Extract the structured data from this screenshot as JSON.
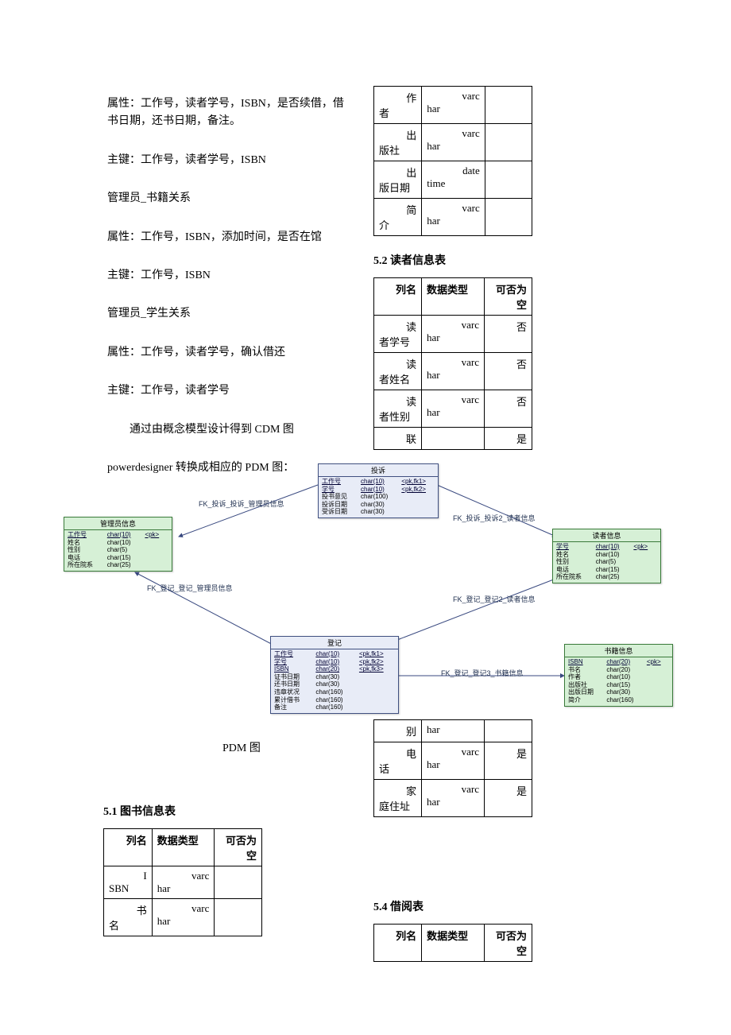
{
  "text": {
    "p1": "属性：工作号，读者学号，ISBN，是否续借，借书日期，还书日期，备注。",
    "p2": "主键：工作号，读者学号，ISBN",
    "p3": "管理员_书籍关系",
    "p4": "属性：工作号，ISBN，添加时间，是否在馆",
    "p5": "主键：工作号，ISBN",
    "p6": "管理员_学生关系",
    "p7": "属性：工作号，读者学号，确认借还",
    "p8": "主键：工作号，读者学号",
    "p9": "通过由概念模型设计得到 CDM 图",
    "p10": "powerdesigner 转换成相应的 PDM 图：",
    "pdm_label": "PDM 图",
    "sec51": "5.1 图书信息表",
    "sec52": "5.2 读者信息表",
    "sec54": "5.4 借阅表",
    "hdr_col": "列名",
    "hdr_type": "数据类型",
    "hdr_type2": "数据类型",
    "hdr_null": "可否为空"
  },
  "table_top": {
    "rows": [
      {
        "c1": "作者",
        "c2a": "varc",
        "c2b": "har",
        "c3": ""
      },
      {
        "c1": "出版社",
        "c2a": "varc",
        "c2b": "har",
        "c3": ""
      },
      {
        "c1": "出版日期",
        "c2a": "date",
        "c2b": "time",
        "c3": ""
      },
      {
        "c1": "简介",
        "c2a": "varc",
        "c2b": "har",
        "c3": ""
      }
    ]
  },
  "table52": {
    "rows": [
      {
        "c1": "读者学号",
        "c2a": "varc",
        "c2b": "har",
        "c3": "否"
      },
      {
        "c1": "读者姓名",
        "c2a": "varc",
        "c2b": "har",
        "c3": "否"
      },
      {
        "c1": "读者性别",
        "c2a": "varc",
        "c2b": "har",
        "c3": "否"
      },
      {
        "c1": "联",
        "c2a": "",
        "c2b": "",
        "c3": "是"
      }
    ]
  },
  "table52b": {
    "rows": [
      {
        "c1": "别",
        "c2a": "",
        "c2b": "har",
        "c3": ""
      },
      {
        "c1": "电话",
        "c2a": "varc",
        "c2b": "har",
        "c3": "是"
      },
      {
        "c1": "家庭住址",
        "c2a": "varc",
        "c2b": "har",
        "c3": "是"
      }
    ]
  },
  "table51": {
    "rows": [
      {
        "c1": "ISBN",
        "c2a": "varc",
        "c2b": "har",
        "c3": ""
      },
      {
        "c1": "书名",
        "c2a": "varc",
        "c2b": "har",
        "c3": ""
      }
    ]
  },
  "table54": {
    "hdr_col_short": "列名",
    "hdr_type_short": "数据类型",
    "hdr_null_short": "可否为空"
  },
  "diagram": {
    "admin": {
      "title": "管理员信息",
      "rows": [
        [
          "工作号",
          "char(10)",
          "<pk>"
        ],
        [
          "姓名",
          "char(10)",
          ""
        ],
        [
          "性别",
          "char(5)",
          ""
        ],
        [
          "电话",
          "char(15)",
          ""
        ],
        [
          "所在院系",
          "char(25)",
          ""
        ]
      ]
    },
    "reader": {
      "title": "读者信息",
      "rows": [
        [
          "学号",
          "char(10)",
          "<pk>"
        ],
        [
          "姓名",
          "char(10)",
          ""
        ],
        [
          "性别",
          "char(5)",
          ""
        ],
        [
          "电话",
          "char(15)",
          ""
        ],
        [
          "所在院系",
          "char(25)",
          ""
        ]
      ]
    },
    "complain": {
      "title": "投诉",
      "rows": [
        [
          "工作号",
          "char(10)",
          "<pk,fk1>"
        ],
        [
          "学号",
          "char(10)",
          "<pk,fk2>"
        ],
        [
          "投书意见",
          "char(100)",
          ""
        ],
        [
          "投诉日期",
          "char(30)",
          ""
        ],
        [
          "受诉日期",
          "char(30)",
          ""
        ]
      ]
    },
    "register": {
      "title": "登记",
      "rows": [
        [
          "工作号",
          "char(10)",
          "<pk,fk1>"
        ],
        [
          "学号",
          "char(10)",
          "<pk,fk2>"
        ],
        [
          "ISBN",
          "char(20)",
          "<pk,fk3>"
        ],
        [
          "证书日期",
          "char(30)",
          ""
        ],
        [
          "还书日期",
          "char(30)",
          ""
        ],
        [
          "违章状况",
          "char(160)",
          ""
        ],
        [
          "累计借书",
          "char(160)",
          ""
        ],
        [
          "备注",
          "char(160)",
          ""
        ]
      ]
    },
    "book": {
      "title": "书籍信息",
      "rows": [
        [
          "ISBN",
          "char(20)",
          "<pk>"
        ],
        [
          "书名",
          "char(20)",
          ""
        ],
        [
          "作者",
          "char(10)",
          ""
        ],
        [
          "出版社",
          "char(15)",
          ""
        ],
        [
          "出版日期",
          "char(30)",
          ""
        ],
        [
          "简介",
          "char(160)",
          ""
        ]
      ]
    },
    "rel1": "FK_投诉_投诉_管理员信息",
    "rel2": "FK_投诉_投诉2_读者信息",
    "rel3": "FK_登记_登记_管理员信息",
    "rel4": "FK_登记_登记2_读者信息",
    "rel5": "FK_登记_登记3_书籍信息"
  }
}
